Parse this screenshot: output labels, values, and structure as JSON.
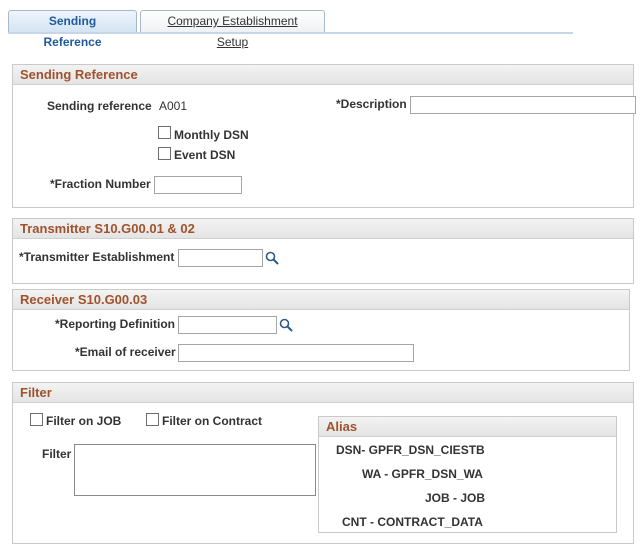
{
  "tabs": [
    {
      "label": "Sending Reference",
      "active": true
    },
    {
      "label": "Company Establishment Setup",
      "active": false
    }
  ],
  "sending_reference": {
    "title": "Sending Reference",
    "sending_reference_label": "Sending reference",
    "sending_reference_value": "A001",
    "description_label": "*Description",
    "description_value": "",
    "monthly_dsn_label": "Monthly DSN",
    "monthly_dsn_checked": false,
    "event_dsn_label": "Event DSN",
    "event_dsn_checked": false,
    "fraction_number_label": "*Fraction Number",
    "fraction_number_value": ""
  },
  "transmitter": {
    "title": "Transmitter S10.G00.01 & 02",
    "establishment_label": "*Transmitter Establishment",
    "establishment_value": ""
  },
  "receiver": {
    "title": "Receiver S10.G00.03",
    "reporting_definition_label": "*Reporting Definition",
    "reporting_definition_value": "",
    "email_label": "*Email of receiver",
    "email_value": ""
  },
  "filter": {
    "title": "Filter",
    "filter_on_job_label": "Filter on JOB",
    "filter_on_job_checked": false,
    "filter_on_contract_label": "Filter on Contract",
    "filter_on_contract_checked": false,
    "filter_label": "Filter",
    "filter_value": ""
  },
  "alias": {
    "title": "Alias",
    "rows": [
      "DSN- GPFR_DSN_CIESTB",
      "WA - GPFR_DSN_WA",
      "JOB - JOB",
      "CNT - CONTRACT_DATA"
    ]
  },
  "icons": {
    "lookup": "magnifier-lookup-icon"
  },
  "colors": {
    "group_title": "#a0522d",
    "active_tab_text": "#1f5a9c"
  }
}
